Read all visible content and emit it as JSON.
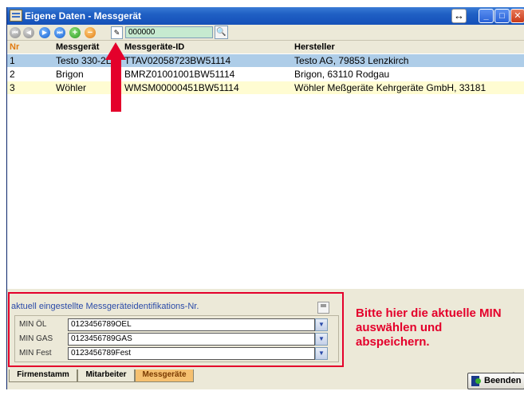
{
  "window": {
    "title": "Eigene Daten - Messgerät"
  },
  "titlebar": {
    "resize_glyph": "↔",
    "min_glyph": "_",
    "max_glyph": "□",
    "close_glyph": "✕"
  },
  "toolbar": {
    "search_value": "000000",
    "nav_icons": [
      "first-record-icon",
      "previous-record-icon",
      "next-record-icon",
      "last-record-icon",
      "add-record-icon",
      "delete-record-icon",
      "edit-record-icon"
    ],
    "search_icon": "search-icon"
  },
  "table": {
    "headers": {
      "nr": "Nr",
      "messgeraet": "Messgerät",
      "id": "Messgeräte-ID",
      "hersteller": "Hersteller"
    },
    "rows": [
      {
        "nr": "1",
        "messgeraet": "Testo 330-2L",
        "id": "TTAV02058723BW51114",
        "hersteller": "Testo AG, 79853 Lenzkirch"
      },
      {
        "nr": "2",
        "messgeraet": "Brigon",
        "id": "BMRZ01001001BW51114",
        "hersteller": "Brigon, 63110 Rodgau"
      },
      {
        "nr": "3",
        "messgeraet": "Wöhler",
        "id": "WMSM00000451BW51114",
        "hersteller": "Wöhler Meßgeräte Kehrgeräte GmbH, 33181"
      }
    ]
  },
  "panel": {
    "title": "aktuell eingestellte Messgeräteidentifikations-Nr.",
    "min_rows": [
      {
        "label": "MIN ÖL",
        "value": "0123456789OEL"
      },
      {
        "label": "MIN GAS",
        "value": "0123456789GAS"
      },
      {
        "label": "MIN Fest",
        "value": "0123456789Fest"
      }
    ],
    "note": "Bitte hier die aktuelle MIN auswählen und abspeichern."
  },
  "tabs": [
    {
      "label": "Firmenstamm"
    },
    {
      "label": "Mitarbeiter"
    },
    {
      "label": "Messgeräte"
    }
  ],
  "buttons": {
    "beenden": "Beenden"
  },
  "colors": {
    "highlight": "#e4002b",
    "title_bar": "#1f5fc4",
    "selected_row": "#aecde8",
    "alt_row": "#fffcd2",
    "active_tab": "#f5c070"
  }
}
